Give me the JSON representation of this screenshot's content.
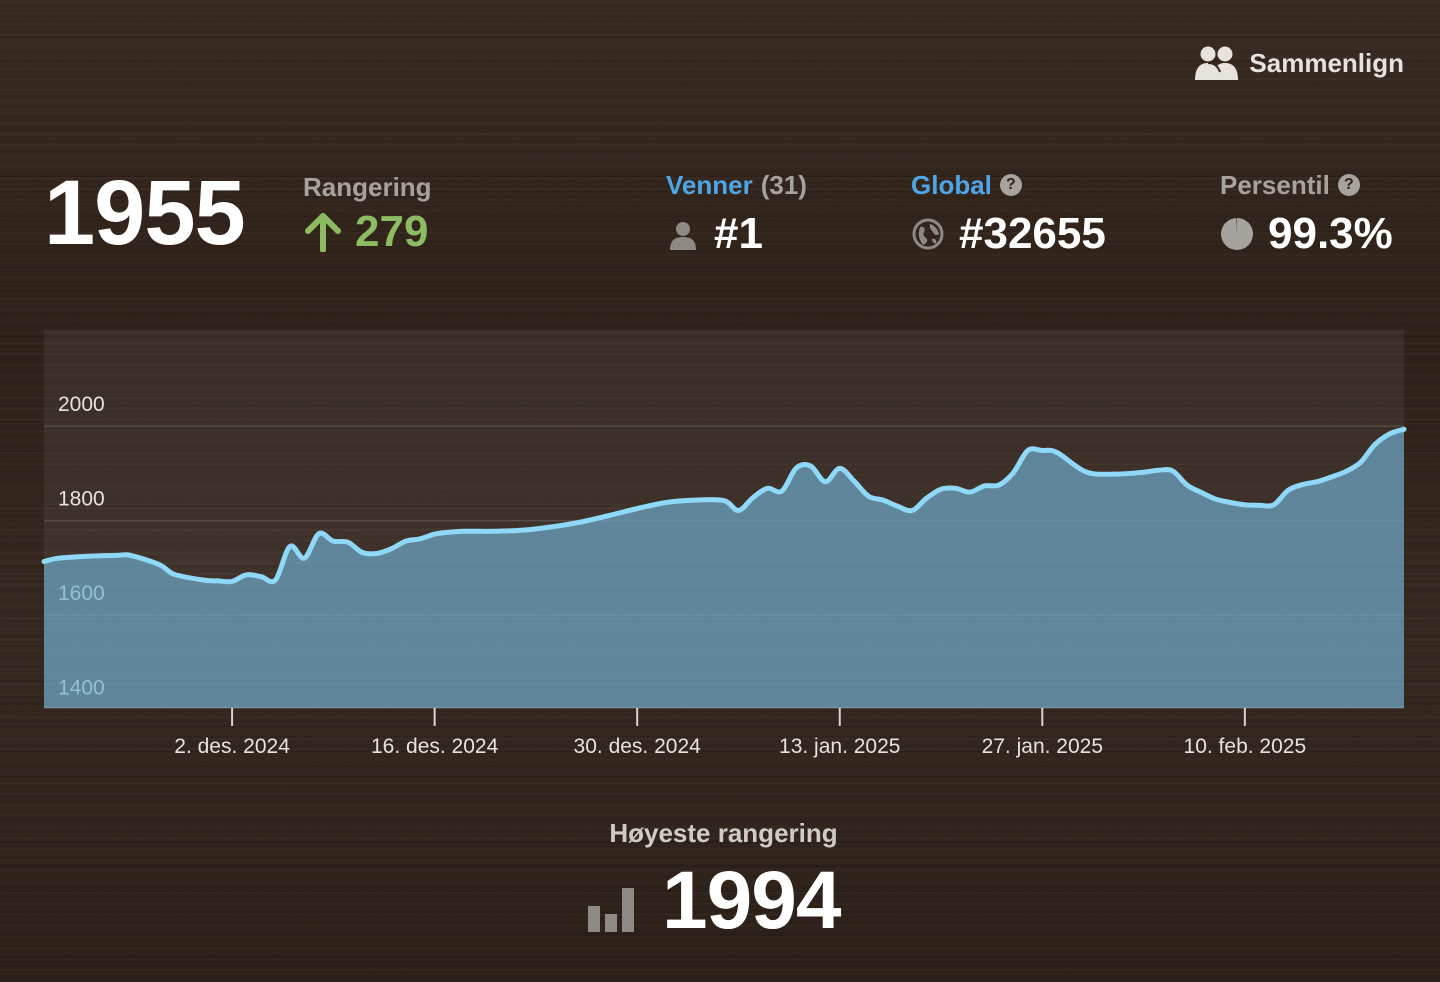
{
  "compare": {
    "label": "Sammenlign",
    "icon": "users-icon"
  },
  "rating": {
    "value": "1955",
    "label": "Rangering",
    "change": "279",
    "change_direction": "up",
    "change_color": "#8cbb62"
  },
  "friends": {
    "label": "Venner",
    "count": "(31)",
    "rank": "#1",
    "icon": "person-icon",
    "color": "#4da6e8"
  },
  "global": {
    "label": "Global",
    "rank": "#32655",
    "icon": "globe-icon",
    "help_icon": "help-icon",
    "color": "#4da6e8"
  },
  "percentile": {
    "label": "Persentil",
    "value": "99.3%",
    "icon": "pie-icon",
    "help_icon": "help-icon"
  },
  "chart_data": {
    "type": "area",
    "title": "",
    "xlabel": "",
    "ylabel": "",
    "ylim": [
      1355,
      2155
    ],
    "xlim": [
      "2024-11-19",
      "2025-02-21"
    ],
    "y_ticks": [
      "1400",
      "1600",
      "1800",
      "2000"
    ],
    "x_ticks": [
      {
        "date": "2024-12-02",
        "label": "2. des. 2024"
      },
      {
        "date": "2024-12-16",
        "label": "16. des. 2024"
      },
      {
        "date": "2024-12-30",
        "label": "30. des. 2024"
      },
      {
        "date": "2025-01-13",
        "label": "13. jan. 2025"
      },
      {
        "date": "2025-01-27",
        "label": "27. jan. 2025"
      },
      {
        "date": "2025-02-10",
        "label": "10. feb. 2025"
      }
    ],
    "grid": true,
    "line_color": "#8fd8f8",
    "fill_color": "#6eaed0",
    "series": [
      {
        "x": [
          "2024-11-19",
          "2024-11-20",
          "2024-11-22",
          "2024-11-24",
          "2024-11-25",
          "2024-11-27",
          "2024-11-28",
          "2024-11-30",
          "2024-12-01",
          "2024-12-02",
          "2024-12-03",
          "2024-12-04",
          "2024-12-05",
          "2024-12-06",
          "2024-12-07",
          "2024-12-08",
          "2024-12-09",
          "2024-12-10",
          "2024-12-11",
          "2024-12-12",
          "2024-12-13",
          "2024-12-14",
          "2024-12-15",
          "2024-12-16",
          "2024-12-17",
          "2024-12-18",
          "2024-12-20",
          "2024-12-22",
          "2024-12-24",
          "2024-12-26",
          "2024-12-28",
          "2024-12-30",
          "2025-01-01",
          "2025-01-03",
          "2025-01-05",
          "2025-01-06",
          "2025-01-07",
          "2025-01-08",
          "2025-01-09",
          "2025-01-10",
          "2025-01-11",
          "2025-01-12",
          "2025-01-13",
          "2025-01-14",
          "2025-01-15",
          "2025-01-16",
          "2025-01-17",
          "2025-01-18",
          "2025-01-19",
          "2025-01-20",
          "2025-01-21",
          "2025-01-22",
          "2025-01-23",
          "2025-01-24",
          "2025-01-25",
          "2025-01-26",
          "2025-01-27",
          "2025-01-28",
          "2025-01-30",
          "2025-02-01",
          "2025-02-03",
          "2025-02-04",
          "2025-02-05",
          "2025-02-06",
          "2025-02-07",
          "2025-02-08",
          "2025-02-09",
          "2025-02-10",
          "2025-02-11",
          "2025-02-12",
          "2025-02-13",
          "2025-02-14",
          "2025-02-15",
          "2025-02-16",
          "2025-02-17",
          "2025-02-18",
          "2025-02-19",
          "2025-02-20",
          "2025-02-21"
        ],
        "y": [
          1665,
          1672,
          1676,
          1678,
          1678,
          1658,
          1638,
          1626,
          1624,
          1623,
          1637,
          1633,
          1626,
          1697,
          1672,
          1724,
          1708,
          1706,
          1684,
          1682,
          1692,
          1708,
          1713,
          1723,
          1727,
          1729,
          1729,
          1731,
          1738,
          1748,
          1762,
          1777,
          1790,
          1795,
          1794,
          1773,
          1800,
          1820,
          1814,
          1863,
          1867,
          1834,
          1862,
          1835,
          1803,
          1795,
          1782,
          1773,
          1799,
          1818,
          1820,
          1812,
          1825,
          1827,
          1853,
          1900,
          1900,
          1896,
          1855,
          1850,
          1854,
          1858,
          1857,
          1827,
          1811,
          1797,
          1790,
          1785,
          1784,
          1785,
          1816,
          1828,
          1834,
          1844,
          1856,
          1875,
          1913,
          1935,
          1945
        ]
      }
    ]
  },
  "best": {
    "label": "Høyeste rangering",
    "value": "1994",
    "icon": "bar-chart-icon"
  }
}
